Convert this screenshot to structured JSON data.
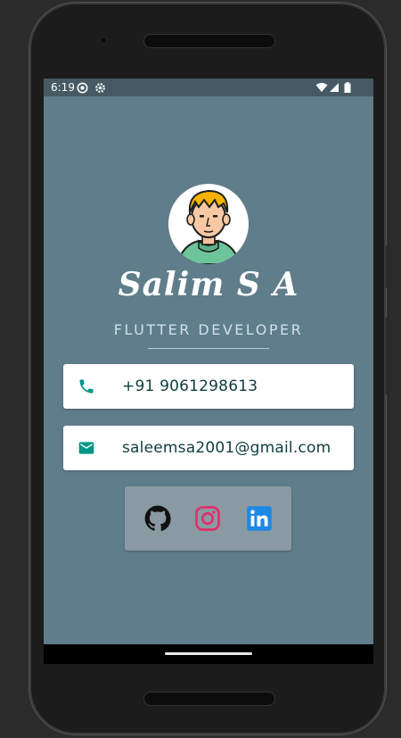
{
  "statusbar": {
    "time": "6:19"
  },
  "profile": {
    "name": "Salim S A",
    "title": "FLUTTER DEVELOPER"
  },
  "contacts": {
    "phone": "+91 9061298613",
    "email": "saleemsa2001@gmail.com"
  },
  "social": {
    "icons": [
      "github-icon",
      "instagram-icon",
      "linkedin-icon"
    ]
  },
  "colors": {
    "background": "#607d8b",
    "statusbar": "#455a64",
    "accent": "#009688",
    "text": "#0f3d3e"
  }
}
